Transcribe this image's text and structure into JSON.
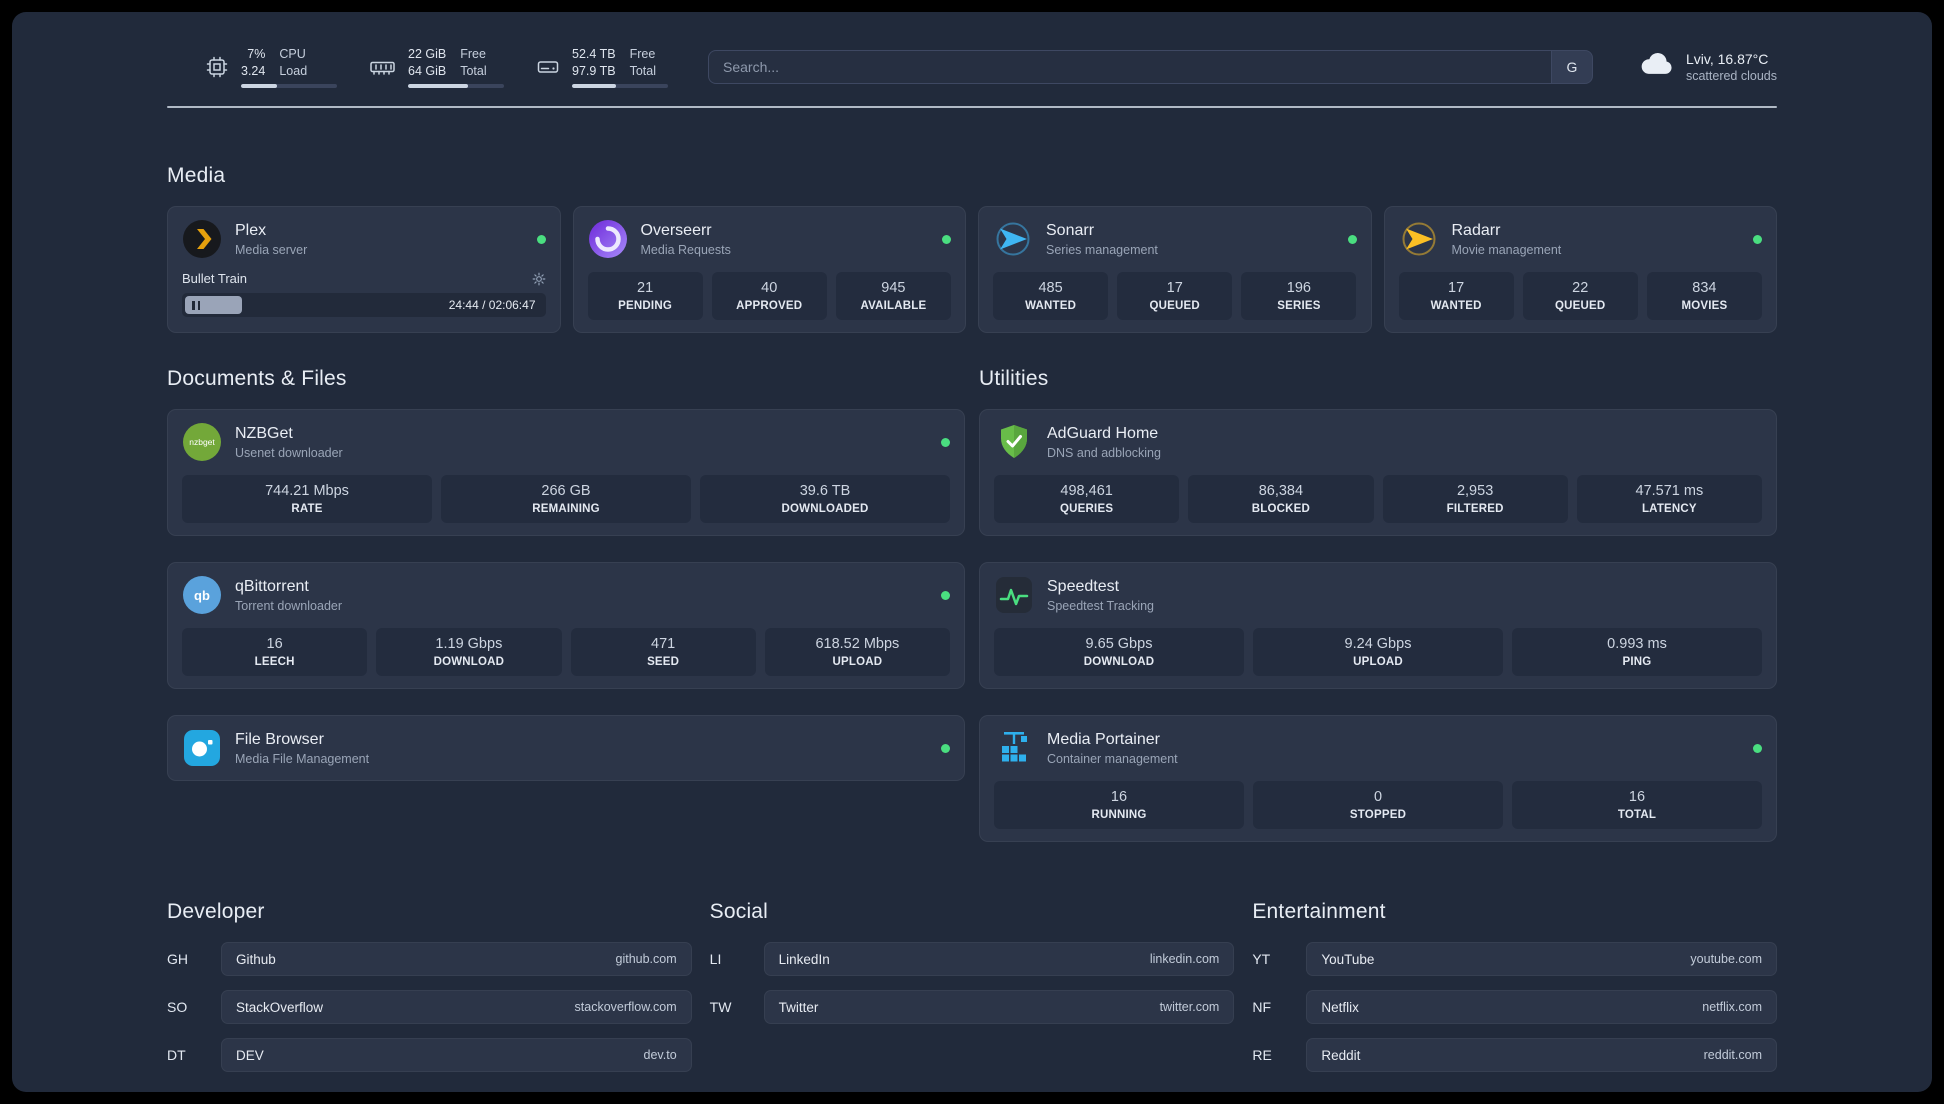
{
  "topbar": {
    "cpu": {
      "value": "7%",
      "sub": "3.24",
      "label_top": "CPU",
      "label_bottom": "Load",
      "bar_percent": 38
    },
    "memory": {
      "value": "22 GiB",
      "sub": "64 GiB",
      "label_top": "Free",
      "label_bottom": "Total",
      "bar_percent": 63
    },
    "disk": {
      "value": "52.4 TB",
      "sub": "97.9 TB",
      "label_top": "Free",
      "label_bottom": "Total",
      "bar_percent": 46
    },
    "search": {
      "placeholder": "Search...",
      "button_label": "G"
    },
    "weather": {
      "location": "Lviv, 16.87°C",
      "condition": "scattered clouds"
    }
  },
  "section_titles": {
    "media": "Media",
    "documents": "Documents & Files",
    "utilities": "Utilities",
    "developer": "Developer",
    "social": "Social",
    "entertainment": "Entertainment"
  },
  "services": {
    "plex": {
      "name": "Plex",
      "subtitle": "Media server",
      "player": {
        "track": "Bullet Train",
        "time": "24:44 / 02:06:47",
        "progress_percent": 16
      }
    },
    "overseerr": {
      "name": "Overseerr",
      "subtitle": "Media Requests",
      "stats": [
        {
          "value": "21",
          "label": "PENDING"
        },
        {
          "value": "40",
          "label": "APPROVED"
        },
        {
          "value": "945",
          "label": "AVAILABLE"
        }
      ]
    },
    "sonarr": {
      "name": "Sonarr",
      "subtitle": "Series management",
      "stats": [
        {
          "value": "485",
          "label": "WANTED"
        },
        {
          "value": "17",
          "label": "QUEUED"
        },
        {
          "value": "196",
          "label": "SERIES"
        }
      ]
    },
    "radarr": {
      "name": "Radarr",
      "subtitle": "Movie management",
      "stats": [
        {
          "value": "17",
          "label": "WANTED"
        },
        {
          "value": "22",
          "label": "QUEUED"
        },
        {
          "value": "834",
          "label": "MOVIES"
        }
      ]
    },
    "nzbget": {
      "name": "NZBGet",
      "subtitle": "Usenet downloader",
      "stats": [
        {
          "value": "744.21 Mbps",
          "label": "RATE"
        },
        {
          "value": "266 GB",
          "label": "REMAINING"
        },
        {
          "value": "39.6 TB",
          "label": "DOWNLOADED"
        }
      ]
    },
    "qbittorrent": {
      "name": "qBittorrent",
      "subtitle": "Torrent downloader",
      "stats": [
        {
          "value": "16",
          "label": "LEECH"
        },
        {
          "value": "1.19 Gbps",
          "label": "DOWNLOAD"
        },
        {
          "value": "471",
          "label": "SEED"
        },
        {
          "value": "618.52 Mbps",
          "label": "UPLOAD"
        }
      ]
    },
    "filebrowser": {
      "name": "File Browser",
      "subtitle": "Media File Management"
    },
    "adguard": {
      "name": "AdGuard Home",
      "subtitle": "DNS and adblocking",
      "stats": [
        {
          "value": "498,461",
          "label": "QUERIES"
        },
        {
          "value": "86,384",
          "label": "BLOCKED"
        },
        {
          "value": "2,953",
          "label": "FILTERED"
        },
        {
          "value": "47.571 ms",
          "label": "LATENCY"
        }
      ]
    },
    "speedtest": {
      "name": "Speedtest",
      "subtitle": "Speedtest Tracking",
      "stats": [
        {
          "value": "9.65 Gbps",
          "label": "DOWNLOAD"
        },
        {
          "value": "9.24 Gbps",
          "label": "UPLOAD"
        },
        {
          "value": "0.993 ms",
          "label": "PING"
        }
      ]
    },
    "portainer": {
      "name": "Media Portainer",
      "subtitle": "Container management",
      "stats": [
        {
          "value": "16",
          "label": "RUNNING"
        },
        {
          "value": "0",
          "label": "STOPPED"
        },
        {
          "value": "16",
          "label": "TOTAL"
        }
      ]
    }
  },
  "bookmarks": {
    "developer": [
      {
        "abbr": "GH",
        "name": "Github",
        "url": "github.com"
      },
      {
        "abbr": "SO",
        "name": "StackOverflow",
        "url": "stackoverflow.com"
      },
      {
        "abbr": "DT",
        "name": "DEV",
        "url": "dev.to"
      }
    ],
    "social": [
      {
        "abbr": "LI",
        "name": "LinkedIn",
        "url": "linkedin.com"
      },
      {
        "abbr": "TW",
        "name": "Twitter",
        "url": "twitter.com"
      }
    ],
    "entertainment": [
      {
        "abbr": "YT",
        "name": "YouTube",
        "url": "youtube.com"
      },
      {
        "abbr": "NF",
        "name": "Netflix",
        "url": "netflix.com"
      },
      {
        "abbr": "RE",
        "name": "Reddit",
        "url": "reddit.com"
      }
    ]
  },
  "icons": {
    "cpu": "chip",
    "memory": "ram-stick",
    "storage": "hard-drive",
    "weather": "cloud",
    "settings": "gear",
    "playback_state": "pause"
  },
  "colors": {
    "panel_bg": "#212a3b",
    "card_bg": "#2c3548",
    "status_online": "#4ade80",
    "plex_accent": "#e5a00d",
    "adguard_green": "#68bd49",
    "portainer_blue": "#2eb0ed"
  }
}
